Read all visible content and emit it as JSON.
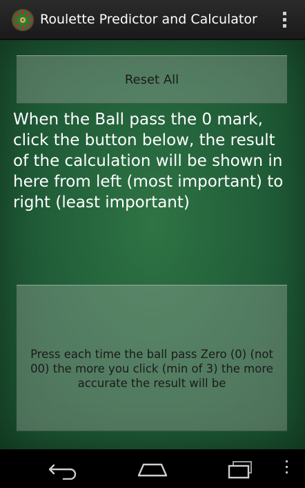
{
  "app": {
    "title": "Roulette Predictor and Calculator",
    "icon": "roulette-wheel-icon"
  },
  "buttons": {
    "reset_label": "Reset All",
    "press_label": "Press each time the ball pass Zero (0) (not 00) the more you click (min of 3) the more accurate the result will be"
  },
  "instructions": "When the Ball pass the 0 mark, click the button below, the result of the calculation will be shown in here from left (most important) to right (least important)",
  "nav": {
    "icons": [
      "back-icon",
      "home-icon",
      "recent-apps-icon",
      "overflow-icon"
    ]
  },
  "colors": {
    "felt": "#22603a",
    "action_bar": "#222222"
  }
}
